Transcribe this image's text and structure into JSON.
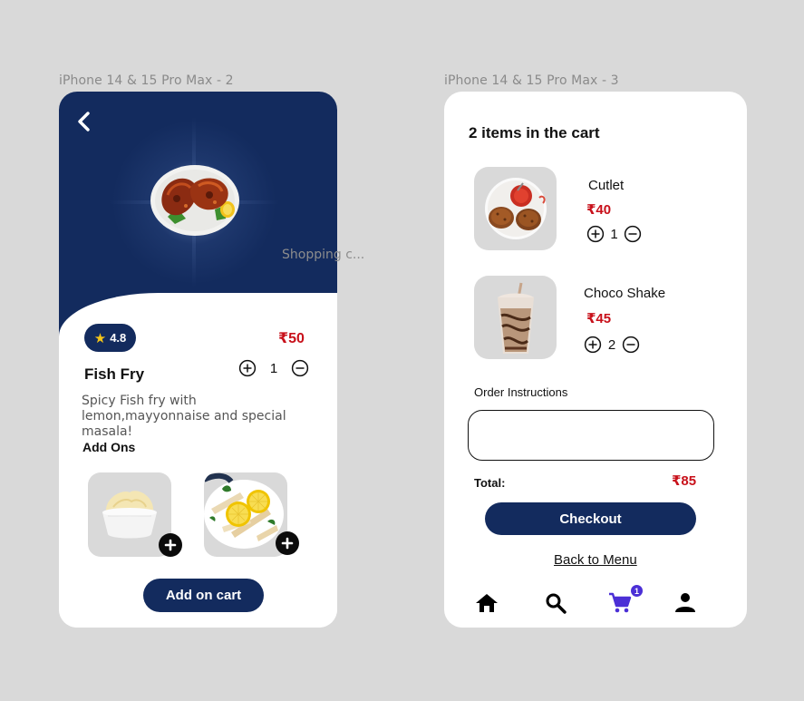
{
  "frames": {
    "left_label": "iPhone 14 & 15 Pro Max - 2",
    "right_label": "iPhone 14 & 15 Pro Max - 3",
    "stray_label": "Shopping c..."
  },
  "colors": {
    "navy": "#132b5e",
    "price_red": "#c8101a",
    "card_gray": "#d9d9d9",
    "cart_active": "#4b2fd6"
  },
  "detail": {
    "back_icon": "chevron-left-icon",
    "rating": "4.8",
    "rating_icon": "star-icon",
    "price": "₹50",
    "name": "Fish Fry",
    "quantity": "1",
    "description": "Spicy Fish fry with lemon,mayyonnaise and special masala!",
    "addons_title": "Add Ons",
    "addons": [
      {
        "image": "mayonnaise-bowl",
        "add_icon": "plus-icon"
      },
      {
        "image": "lemon-fries-plate",
        "add_icon": "plus-icon"
      }
    ],
    "add_button": "Add on cart"
  },
  "cart": {
    "title": "2 items in the cart",
    "items": [
      {
        "name": "Cutlet",
        "price": "₹40",
        "quantity": "1",
        "image": "cutlet-plate"
      },
      {
        "name": "Choco Shake",
        "price": "₹45",
        "quantity": "2",
        "image": "choco-shake-glass"
      }
    ],
    "instructions_label": "Order Instructions",
    "instructions_value": "",
    "total_label": "Total:",
    "total_value": "₹85",
    "checkout_button": "Checkout",
    "back_link": "Back to Menu",
    "nav": [
      {
        "icon": "home-icon"
      },
      {
        "icon": "search-icon"
      },
      {
        "icon": "cart-icon",
        "active": true,
        "badge": "1"
      },
      {
        "icon": "profile-icon"
      }
    ]
  }
}
